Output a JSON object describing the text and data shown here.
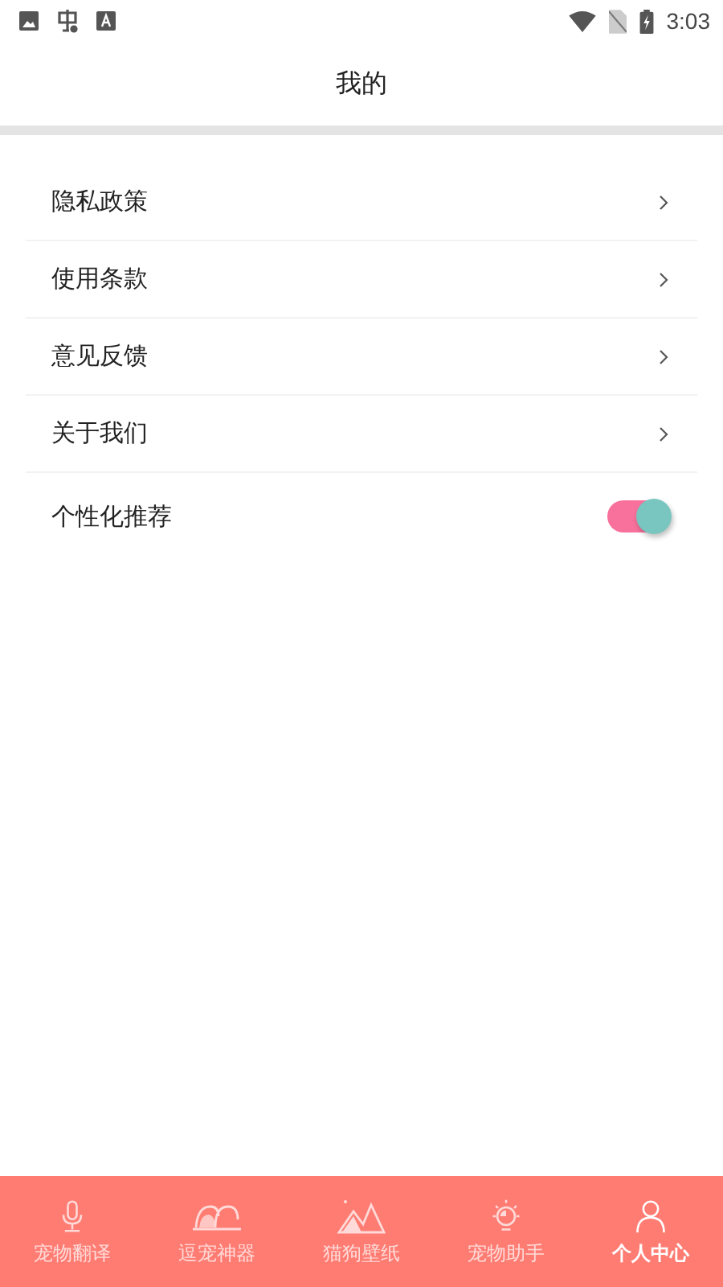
{
  "status_bar": {
    "time": "3:03"
  },
  "header": {
    "title": "我的"
  },
  "menu": [
    {
      "kind": "link",
      "label": "隐私政策"
    },
    {
      "kind": "link",
      "label": "使用条款"
    },
    {
      "kind": "link",
      "label": "意见反馈"
    },
    {
      "kind": "link",
      "label": "关于我们"
    },
    {
      "kind": "toggle",
      "label": "个性化推荐",
      "on": true
    }
  ],
  "bottom_nav": [
    {
      "kind": "mic",
      "label": "宠物翻译",
      "selected": false
    },
    {
      "kind": "paws",
      "label": "逗宠神器",
      "selected": false
    },
    {
      "kind": "mountains",
      "label": "猫狗壁纸",
      "selected": false
    },
    {
      "kind": "bulb",
      "label": "宠物助手",
      "selected": false
    },
    {
      "kind": "person",
      "label": "个人中心",
      "selected": true
    }
  ]
}
